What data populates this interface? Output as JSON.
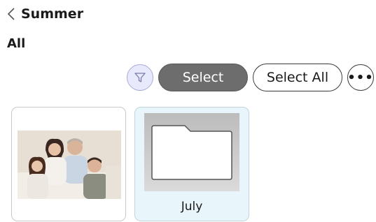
{
  "header": {
    "title": "Summer",
    "back_icon": "chevron-left-icon"
  },
  "filter_label": "All",
  "toolbar": {
    "filter_icon": "funnel-icon",
    "select_label": "Select",
    "select_all_label": "Select All",
    "more_label": "•••",
    "more_icon": "ellipsis-icon"
  },
  "items": [
    {
      "type": "photo",
      "icon": "family-photo-thumbnail"
    },
    {
      "type": "folder",
      "name": "July",
      "icon": "folder-icon"
    }
  ],
  "colors": {
    "select_fill": "#6d6d6d",
    "filter_fill": "#e8e9fb",
    "folder_tile_bg": "#e8f6fc"
  }
}
